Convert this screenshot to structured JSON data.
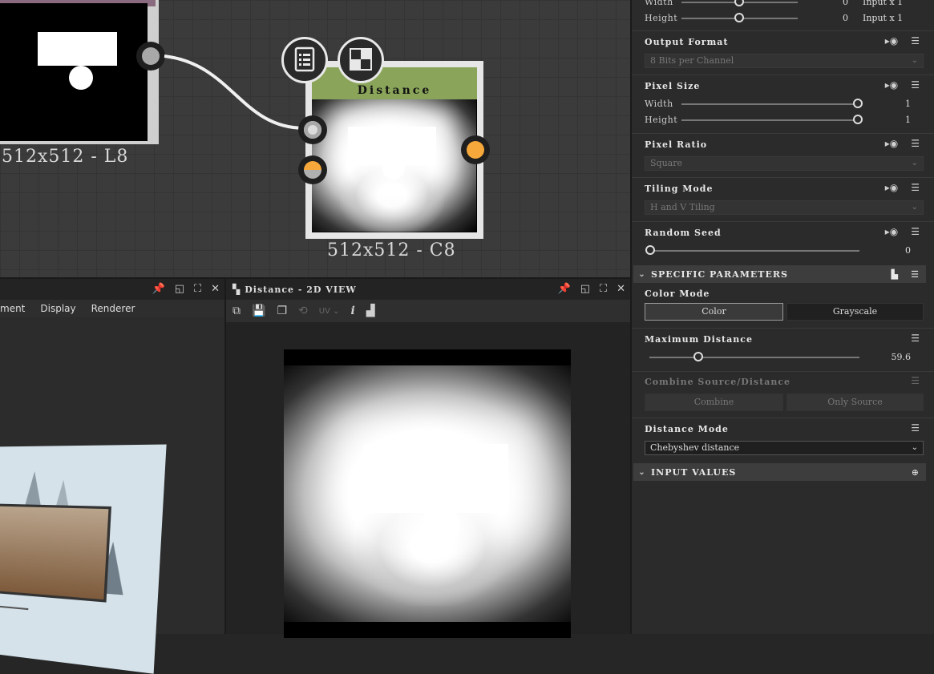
{
  "graph": {
    "left_node_label": "512x512 - L8",
    "dist_node_title": "Distance",
    "dist_node_label": "512x512 - C8"
  },
  "panel3d": {
    "menu": [
      "ment",
      "Display",
      "Renderer"
    ]
  },
  "view2d": {
    "title": "Distance - 2D VIEW",
    "uv_label": "UV",
    "info_label": "i"
  },
  "props": {
    "top": {
      "width_label": "Width",
      "width_value": "0",
      "width_suffix": "Input x 1",
      "height_label": "Height",
      "height_value": "0",
      "height_suffix": "Input x 1"
    },
    "output_format": {
      "label": "Output Format",
      "value": "8 Bits per Channel"
    },
    "pixel_size": {
      "label": "Pixel Size",
      "width_label": "Width",
      "width_value": "1",
      "height_label": "Height",
      "height_value": "1"
    },
    "pixel_ratio": {
      "label": "Pixel Ratio",
      "value": "Square"
    },
    "tiling_mode": {
      "label": "Tiling Mode",
      "value": "H and V Tiling"
    },
    "random_seed": {
      "label": "Random Seed",
      "value": "0"
    },
    "specific": {
      "header": "SPECIFIC PARAMETERS",
      "color_mode_label": "Color Mode",
      "color_btn": "Color",
      "grayscale_btn": "Grayscale",
      "max_distance_label": "Maximum Distance",
      "max_distance_value": "59.6",
      "combine_label": "Combine Source/Distance",
      "combine_btn": "Combine",
      "only_source_btn": "Only Source",
      "distance_mode_label": "Distance Mode",
      "distance_mode_value": "Chebyshev distance"
    },
    "input_values_header": "INPUT VALUES"
  },
  "colors": {
    "accent_orange": "#f7a83a",
    "node_header_green": "#8aa55a"
  }
}
